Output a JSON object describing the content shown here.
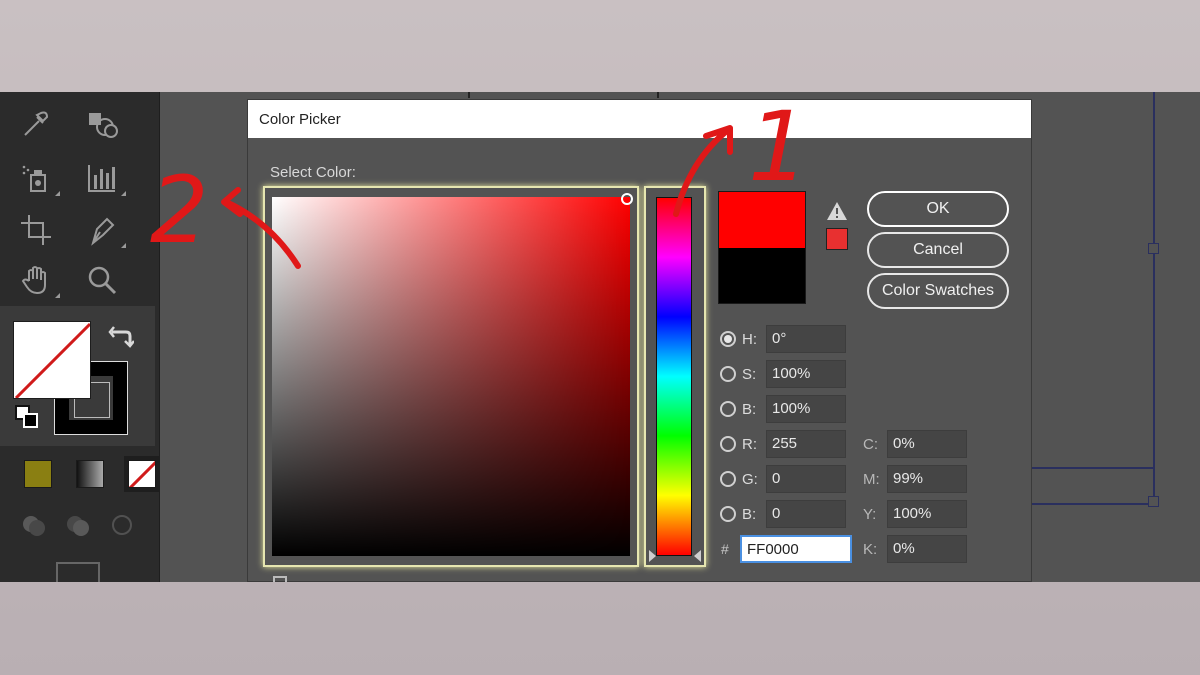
{
  "dialog": {
    "title": "Color Picker",
    "select_label": "Select Color:",
    "buttons": {
      "ok": "OK",
      "cancel": "Cancel",
      "swatches": "Color Swatches"
    },
    "fields": {
      "h": {
        "label": "H:",
        "value": "0°"
      },
      "s": {
        "label": "S:",
        "value": "100%"
      },
      "b": {
        "label": "B:",
        "value": "100%"
      },
      "r": {
        "label": "R:",
        "value": "255"
      },
      "g": {
        "label": "G:",
        "value": "0"
      },
      "blue": {
        "label": "B:",
        "value": "0"
      },
      "c": {
        "label": "C:",
        "value": "0%"
      },
      "m": {
        "label": "M:",
        "value": "99%"
      },
      "y": {
        "label": "Y:",
        "value": "100%"
      },
      "k": {
        "label": "K:",
        "value": "0%"
      },
      "hex": {
        "label": "#",
        "value": "FF0000"
      }
    },
    "selected_radio": "h"
  },
  "colors": {
    "new_color": "#ff0000",
    "old_color": "#000000",
    "gamut_swatch": "#e83030",
    "mode_fill": "#8a7f12",
    "annotation": "#e01818"
  },
  "annotations": {
    "label_1": "1",
    "label_2": "2"
  },
  "toolbar": {
    "tools": [
      "eyedropper-icon",
      "shape-builder-icon",
      "symbol-sprayer-icon",
      "bar-graph-icon",
      "artboard-icon",
      "pen-icon",
      "hand-icon",
      "zoom-icon"
    ]
  }
}
